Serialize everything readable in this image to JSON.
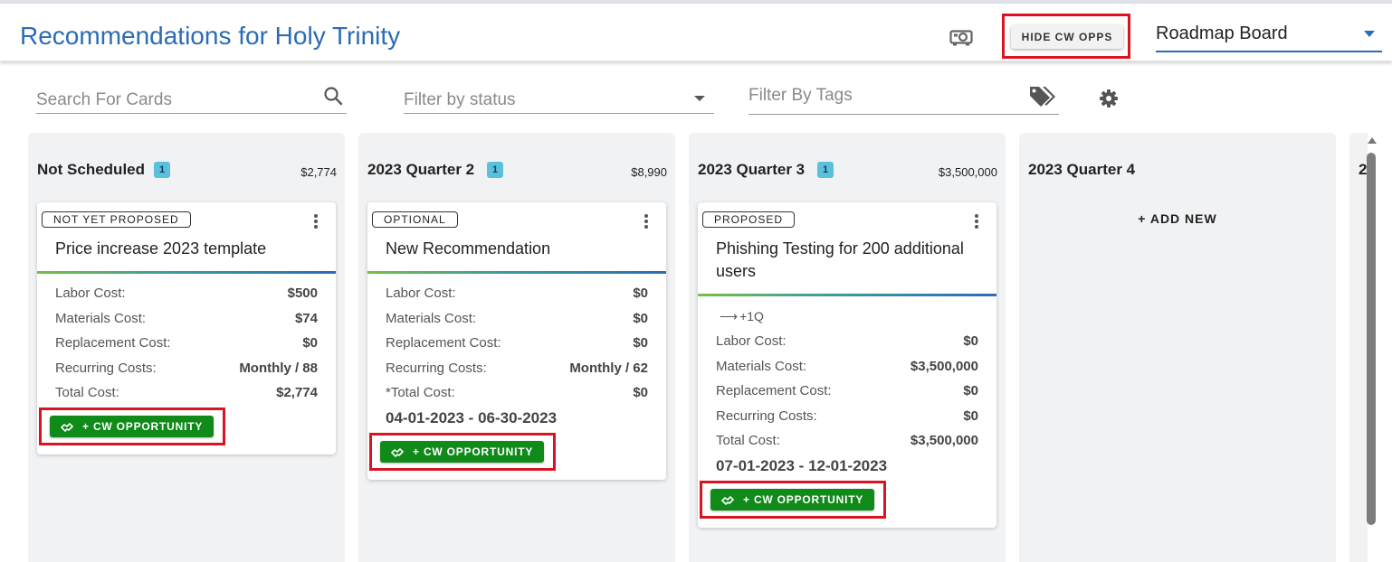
{
  "header": {
    "title": "Recommendations for Holy Trinity",
    "camera_icon": "camera-icon",
    "hide_button_label": "HIDE CW OPPS",
    "board_select_value": "Roadmap Board"
  },
  "filters": {
    "search_placeholder": "Search For Cards",
    "status_placeholder": "Filter by status",
    "tags_placeholder": "Filter By Tags",
    "icons": [
      "search-icon",
      "chevron-down-icon",
      "tags-icon",
      "gear-icon"
    ]
  },
  "colors": {
    "accent_blue": "#2b6cb5",
    "cw_green": "#108a19",
    "highlight_red": "#d9131f",
    "count_badge": "#5bc0de",
    "column_bg": "#f1f2f4"
  },
  "columns": [
    {
      "title": "Not Scheduled",
      "count": "1",
      "total": "$2,774",
      "card": {
        "status": "NOT YET PROPOSED",
        "title": "Price increase 2023 template",
        "costs": [
          {
            "label": "Labor Cost:",
            "value": "$500"
          },
          {
            "label": "Materials Cost:",
            "value": "$74"
          },
          {
            "label": "Replacement Cost:",
            "value": "$0"
          },
          {
            "label": "Recurring Costs:",
            "value": "Monthly / 88"
          },
          {
            "label": "Total Cost:",
            "value": "$2,774"
          }
        ],
        "cw_button": "+ CW OPPORTUNITY"
      }
    },
    {
      "title": "2023 Quarter 2",
      "count": "1",
      "total": "$8,990",
      "card": {
        "status": "OPTIONAL",
        "title": "New Recommendation",
        "costs": [
          {
            "label": "Labor Cost:",
            "value": "$0"
          },
          {
            "label": "Materials Cost:",
            "value": "$0"
          },
          {
            "label": "Replacement Cost:",
            "value": "$0"
          },
          {
            "label": "Recurring Costs:",
            "value": "Monthly / 62"
          },
          {
            "label": "*Total Cost:",
            "value": "$0"
          }
        ],
        "date_range": "04-01-2023 - 06-30-2023",
        "cw_button": "+ CW OPPORTUNITY"
      }
    },
    {
      "title": "2023 Quarter 3",
      "count": "1",
      "total": "$3,500,000",
      "card": {
        "status": "PROPOSED",
        "title": "Phishing Testing for 200 additional users",
        "delta": "+1Q",
        "costs": [
          {
            "label": "Labor Cost:",
            "value": "$0"
          },
          {
            "label": "Materials Cost:",
            "value": "$3,500,000"
          },
          {
            "label": "Replacement Cost:",
            "value": "$0"
          },
          {
            "label": "Recurring Costs:",
            "value": "$0"
          },
          {
            "label": "Total Cost:",
            "value": "$3,500,000"
          }
        ],
        "date_range": "07-01-2023 - 12-01-2023",
        "cw_button": "+ CW OPPORTUNITY"
      }
    },
    {
      "title": "2023 Quarter 4",
      "add_new": "+ ADD NEW"
    }
  ],
  "peek_column_text": "2"
}
